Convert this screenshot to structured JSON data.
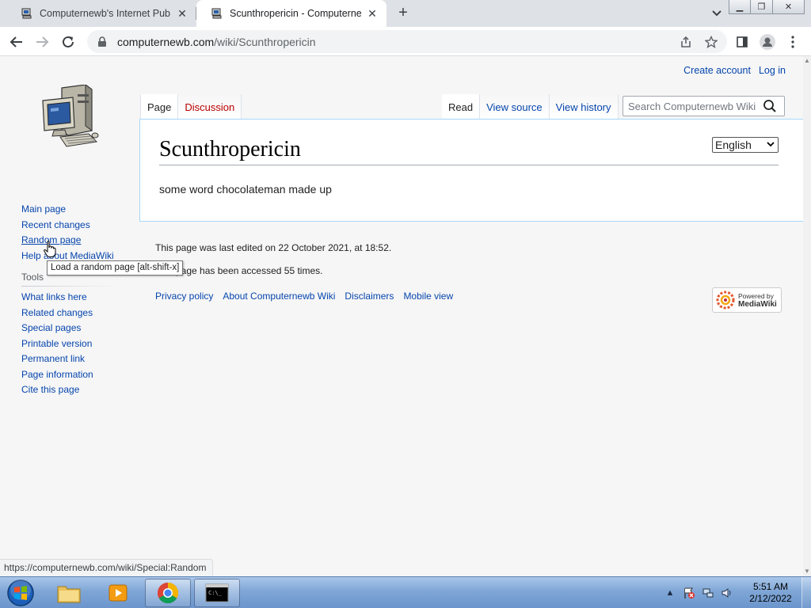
{
  "browser": {
    "tabs": [
      {
        "title": "Computernewb's Internet Pub Hub",
        "icon": "computer-favicon",
        "active": false
      },
      {
        "title": "Scunthropericin - Computernewb",
        "icon": "computer-favicon",
        "active": true
      }
    ],
    "url": {
      "host": "computernewb.com",
      "path": "/wiki/Scunthropericin"
    },
    "status_url": "https://computernewb.com/wiki/Special:Random"
  },
  "wiki": {
    "personal": {
      "create_account": "Create account",
      "log_in": "Log in"
    },
    "nav": [
      "Main page",
      "Recent changes",
      "Random page",
      "Help about MediaWiki"
    ],
    "tools_heading": "Tools",
    "tools": [
      "What links here",
      "Related changes",
      "Special pages",
      "Printable version",
      "Permanent link",
      "Page information",
      "Cite this page"
    ],
    "namespaces": {
      "page": "Page",
      "discussion": "Discussion"
    },
    "views": {
      "read": "Read",
      "view_source": "View source",
      "view_history": "View history"
    },
    "search_placeholder": "Search Computernewb Wiki",
    "title": "Scunthropericin",
    "language": "English",
    "body": "some word chocolateman made up",
    "footer": {
      "last_edited": "This page was last edited on 22 October 2021, at 18:52.",
      "accessed": "This page has been accessed 55 times.",
      "links": [
        "Privacy policy",
        "About Computernewb Wiki",
        "Disclaimers",
        "Mobile view"
      ]
    },
    "powered_by": {
      "line1": "Powered by",
      "line2": "MediaWiki"
    },
    "tooltip": "Load a random page [alt-shift-x]"
  },
  "taskbar": {
    "time": "5:51 AM",
    "date": "2/12/2022"
  },
  "colors": {
    "link": "#0645ad",
    "redlink": "#ba0000",
    "content_border": "#a7d7f9"
  }
}
